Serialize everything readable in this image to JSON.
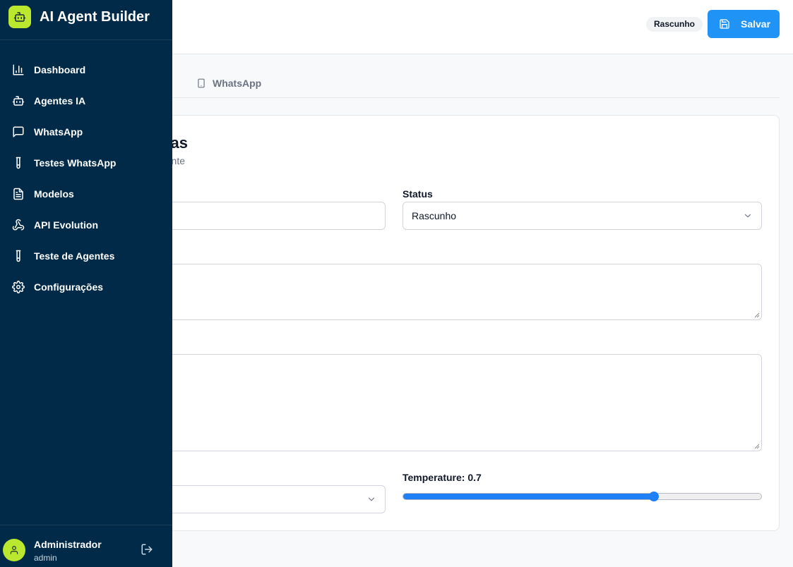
{
  "app": {
    "name": "AI Agent Builder"
  },
  "sidebar": {
    "items": [
      {
        "label": "Dashboard",
        "icon": "bar-chart-icon"
      },
      {
        "label": "Agentes IA",
        "icon": "bot-icon"
      },
      {
        "label": "WhatsApp",
        "icon": "message-square-icon"
      },
      {
        "label": "Testes WhatsApp",
        "icon": "test-tube-icon"
      },
      {
        "label": "Modelos",
        "icon": "file-text-icon"
      },
      {
        "label": "API Evolution",
        "icon": "webhook-icon"
      },
      {
        "label": "Teste de Agentes",
        "icon": "test-tube-icon"
      },
      {
        "label": "Configurações",
        "icon": "gear-icon"
      }
    ],
    "user": {
      "name": "Administrador",
      "role": "admin"
    }
  },
  "header": {
    "status_badge": "Rascunho",
    "save_label": "Salvar"
  },
  "tabs": [
    {
      "label": "WhatsApp",
      "icon": "smartphone-icon"
    }
  ],
  "card": {
    "title_visible": "as",
    "subtitle_visible": "nte",
    "status_label": "Status",
    "status_value": "Rascunho",
    "temperature_label": "Temperature: 0.7",
    "temperature_value": 0.7,
    "temperature_range": [
      0,
      1
    ]
  },
  "colors": {
    "sidebar_bg": "#002a47",
    "accent_lime": "#b9e82e",
    "primary_blue": "#1f93f6"
  }
}
